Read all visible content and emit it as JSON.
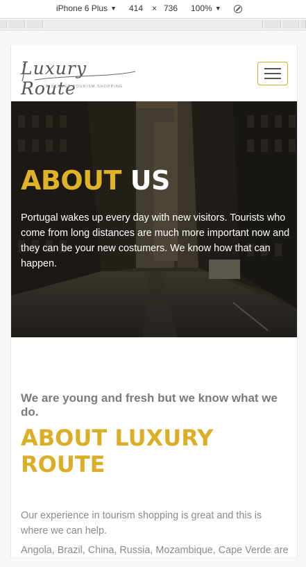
{
  "devtools": {
    "device": "iPhone 6 Plus",
    "width": "414",
    "times": "×",
    "height": "736",
    "zoom": "100%"
  },
  "header": {
    "logo_text": "Luxury Route",
    "logo_tagline": "DISCOVER.TOURISM.SHOPPING"
  },
  "hero": {
    "title_part1": "ABOUT",
    "title_part2": "US",
    "text": "Portugal wakes up every day with new visitors. Tourists who come from long distances are much more important now and they can be your new costumers. We know how that can happen."
  },
  "about": {
    "subheading": "We are young and fresh but we know what we do.",
    "heading": "ABOUT LUXURY ROUTE",
    "paragraph1": "Our experience in tourism shopping is great and this is where we can help.",
    "paragraph2": "Angola, Brazil, China, Russia, Mozambique, Cape Verde are"
  },
  "colors": {
    "accent": "#dcae27",
    "text_gray": "#7a7a7a"
  }
}
